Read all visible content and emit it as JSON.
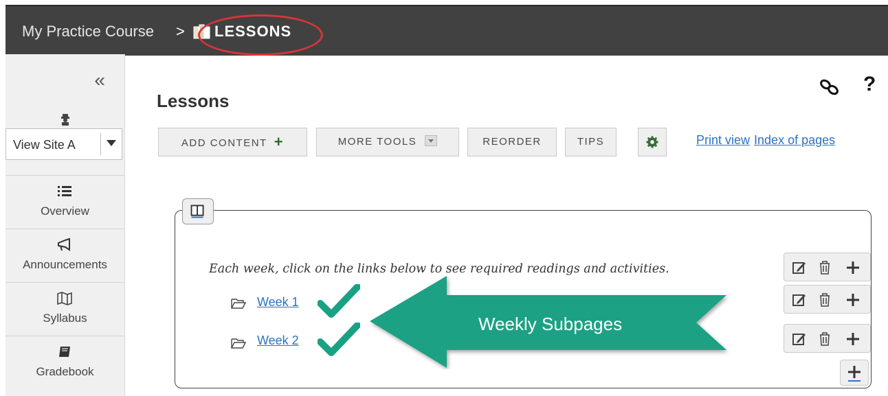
{
  "breadcrumb": {
    "course": "My Practice Course",
    "separator": ">",
    "current": "LESSONS"
  },
  "sidebar": {
    "collapse_label": "«",
    "site_select_value": "View Site A",
    "items": [
      {
        "label": "Overview",
        "icon": "list-icon"
      },
      {
        "label": "Announcements",
        "icon": "megaphone-icon"
      },
      {
        "label": "Syllabus",
        "icon": "map-icon"
      },
      {
        "label": "Gradebook",
        "icon": "book-icon"
      }
    ]
  },
  "main": {
    "title": "Lessons",
    "help": "?",
    "toolbar": {
      "add_content": "ADD CONTENT",
      "more_tools": "MORE TOOLS",
      "reorder": "REORDER",
      "tips": "TIPS"
    },
    "links": {
      "print_view": "Print view",
      "index_of_pages": "Index of pages"
    },
    "section": {
      "intro": "Each week, click on the links below to see required readings and activities.",
      "pages": [
        "Week 1",
        "Week 2"
      ]
    },
    "callout": "Weekly Subpages"
  },
  "colors": {
    "topbar": "#414141",
    "highlight": "#d9343a",
    "callout": "#1aa184",
    "check": "#1aa184",
    "link": "#2a73c4",
    "add_plus": "#2e6b2e"
  }
}
